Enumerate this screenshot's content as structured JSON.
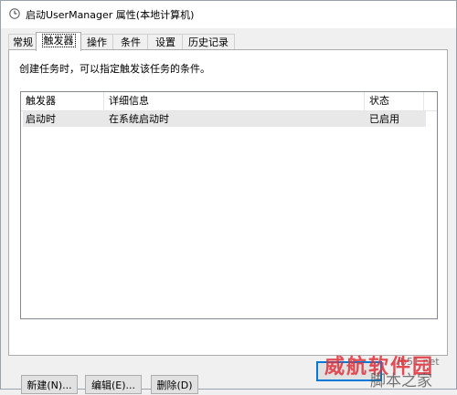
{
  "window": {
    "title": "启动UserManager 属性(本地计算机)",
    "icon": "clock-icon"
  },
  "tabs": [
    {
      "label": "常规",
      "active": false
    },
    {
      "label": "触发器",
      "active": true
    },
    {
      "label": "操作",
      "active": false
    },
    {
      "label": "条件",
      "active": false
    },
    {
      "label": "设置",
      "active": false
    },
    {
      "label": "历史记录",
      "active": false
    }
  ],
  "triggers_tab": {
    "description": "创建任务时，可以指定触发该任务的条件。",
    "columns": [
      "触发器",
      "详细信息",
      "状态"
    ],
    "rows": [
      {
        "trigger": "启动时",
        "details": "在系统启动时",
        "status": "已启用"
      }
    ],
    "buttons": {
      "new": "新建(N)...",
      "edit": "编辑(E)...",
      "delete": "删除(D)"
    }
  },
  "watermark": {
    "main": "威航软件园",
    "sub": "脚本之家",
    "site": "jb51.net"
  }
}
